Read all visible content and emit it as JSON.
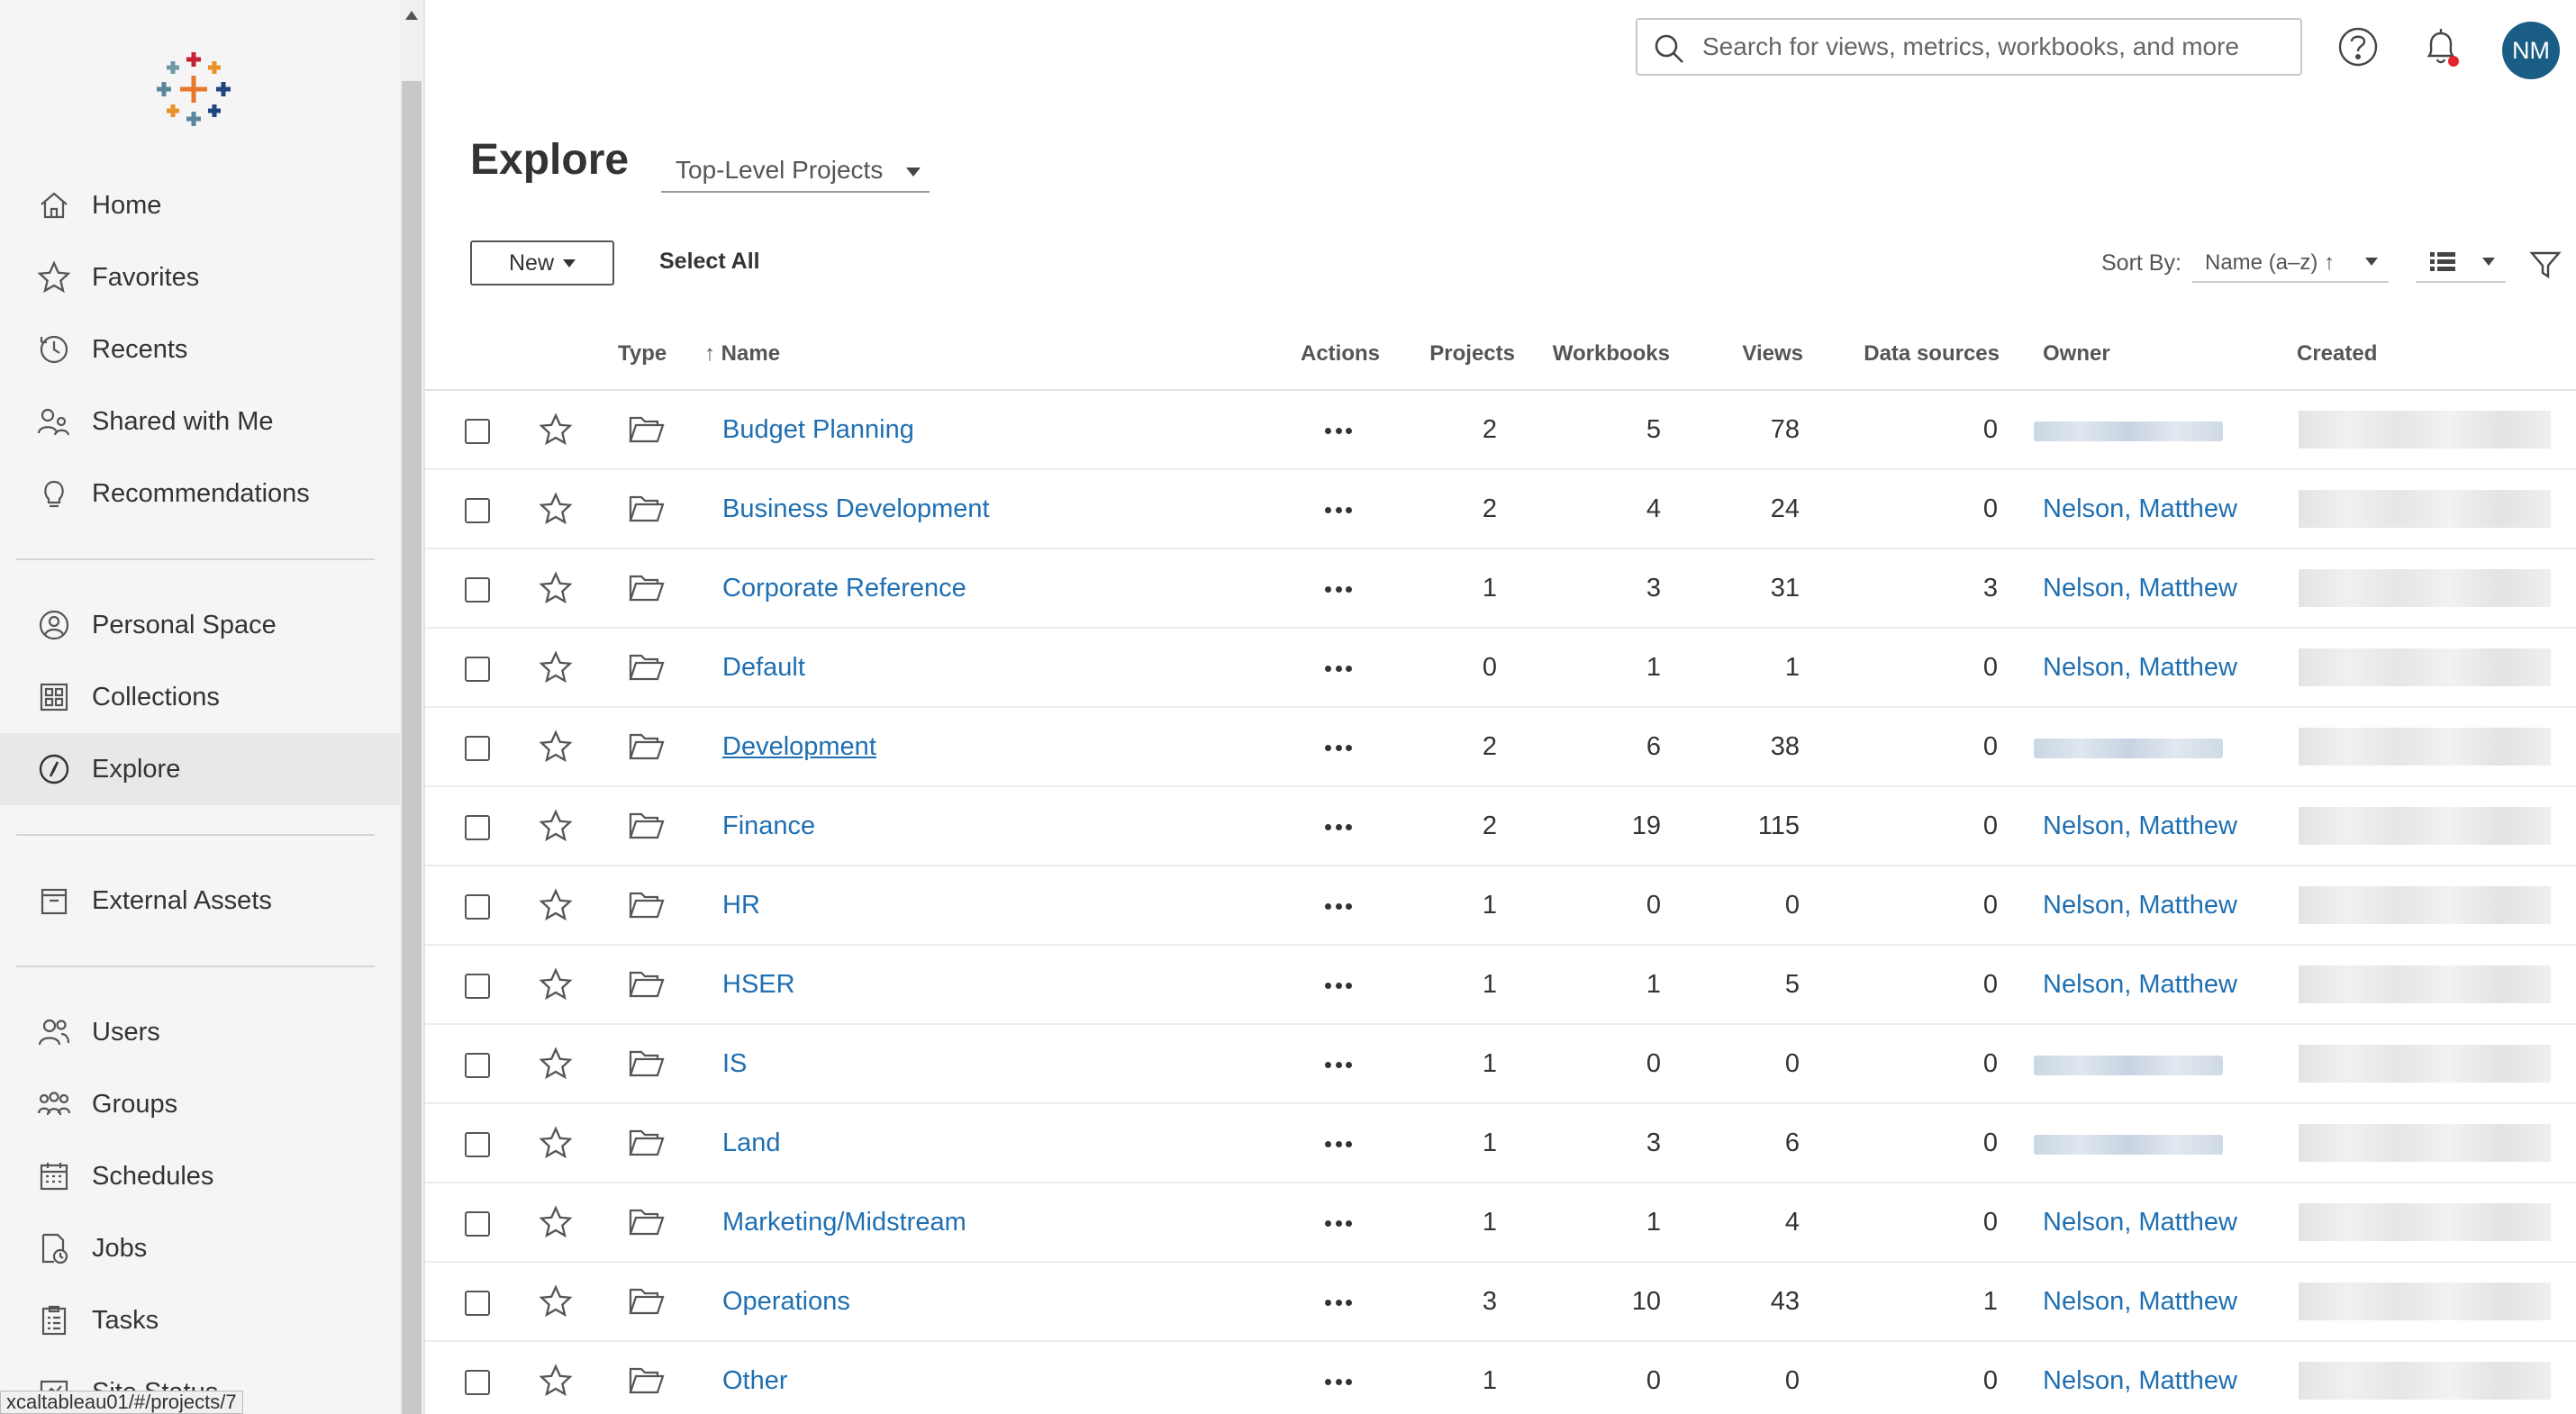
{
  "sidebar": {
    "nav_group_1": [
      {
        "id": "home",
        "label": "Home",
        "icon": "home-icon"
      },
      {
        "id": "favorites",
        "label": "Favorites",
        "icon": "star-icon"
      },
      {
        "id": "recents",
        "label": "Recents",
        "icon": "clock-icon"
      },
      {
        "id": "shared",
        "label": "Shared with Me",
        "icon": "shared-users-icon"
      },
      {
        "id": "recommendations",
        "label": "Recommendations",
        "icon": "lightbulb-icon"
      }
    ],
    "nav_group_2": [
      {
        "id": "personal-space",
        "label": "Personal Space",
        "icon": "user-circle-icon"
      },
      {
        "id": "collections",
        "label": "Collections",
        "icon": "collections-icon"
      },
      {
        "id": "explore",
        "label": "Explore",
        "icon": "compass-icon",
        "active": true
      }
    ],
    "nav_group_3": [
      {
        "id": "external-assets",
        "label": "External Assets",
        "icon": "archive-icon"
      }
    ],
    "nav_group_4": [
      {
        "id": "users",
        "label": "Users",
        "icon": "users-icon"
      },
      {
        "id": "groups",
        "label": "Groups",
        "icon": "groups-icon"
      },
      {
        "id": "schedules",
        "label": "Schedules",
        "icon": "calendar-icon"
      },
      {
        "id": "jobs",
        "label": "Jobs",
        "icon": "jobs-icon"
      },
      {
        "id": "tasks",
        "label": "Tasks",
        "icon": "tasks-icon"
      },
      {
        "id": "site-status",
        "label": "Site Status",
        "icon": "status-icon"
      }
    ],
    "status_url": "xcaltableau01/#/projects/7"
  },
  "topbar": {
    "search_placeholder": "Search for views, metrics, workbooks, and more",
    "avatar_initials": "NM",
    "accent_color": "#1b5e85",
    "notification_dot_color": "#e0262b"
  },
  "page": {
    "title": "Explore",
    "project_filter": "Top-Level Projects",
    "new_label": "New",
    "select_all_label": "Select All",
    "sort_by_label": "Sort By:",
    "sort_value": "Name (a–z) ↑"
  },
  "table": {
    "headers": {
      "type": "Type",
      "name": "↑ Name",
      "actions": "Actions",
      "projects": "Projects",
      "workbooks": "Workbooks",
      "views": "Views",
      "data_sources": "Data sources",
      "owner": "Owner",
      "created": "Created"
    },
    "rows": [
      {
        "name": "Budget Planning",
        "projects": "2",
        "workbooks": "5",
        "views": "78",
        "data_sources": "0",
        "owner": ""
      },
      {
        "name": "Business Development",
        "projects": "2",
        "workbooks": "4",
        "views": "24",
        "data_sources": "0",
        "owner": "Nelson, Matthew"
      },
      {
        "name": "Corporate Reference",
        "projects": "1",
        "workbooks": "3",
        "views": "31",
        "data_sources": "3",
        "owner": "Nelson, Matthew"
      },
      {
        "name": "Default",
        "projects": "0",
        "workbooks": "1",
        "views": "1",
        "data_sources": "0",
        "owner": "Nelson, Matthew"
      },
      {
        "name": "Development",
        "projects": "2",
        "workbooks": "6",
        "views": "38",
        "data_sources": "0",
        "owner": "",
        "hovered": true
      },
      {
        "name": "Finance",
        "projects": "2",
        "workbooks": "19",
        "views": "115",
        "data_sources": "0",
        "owner": "Nelson, Matthew"
      },
      {
        "name": "HR",
        "projects": "1",
        "workbooks": "0",
        "views": "0",
        "data_sources": "0",
        "owner": "Nelson, Matthew"
      },
      {
        "name": "HSER",
        "projects": "1",
        "workbooks": "1",
        "views": "5",
        "data_sources": "0",
        "owner": "Nelson, Matthew"
      },
      {
        "name": "IS",
        "projects": "1",
        "workbooks": "0",
        "views": "0",
        "data_sources": "0",
        "owner": ""
      },
      {
        "name": "Land",
        "projects": "1",
        "workbooks": "3",
        "views": "6",
        "data_sources": "0",
        "owner": ""
      },
      {
        "name": "Marketing/Midstream",
        "projects": "1",
        "workbooks": "1",
        "views": "4",
        "data_sources": "0",
        "owner": "Nelson, Matthew"
      },
      {
        "name": "Operations",
        "projects": "3",
        "workbooks": "10",
        "views": "43",
        "data_sources": "1",
        "owner": "Nelson, Matthew"
      },
      {
        "name": "Other",
        "projects": "1",
        "workbooks": "0",
        "views": "0",
        "data_sources": "0",
        "owner": "Nelson, Matthew"
      }
    ]
  }
}
